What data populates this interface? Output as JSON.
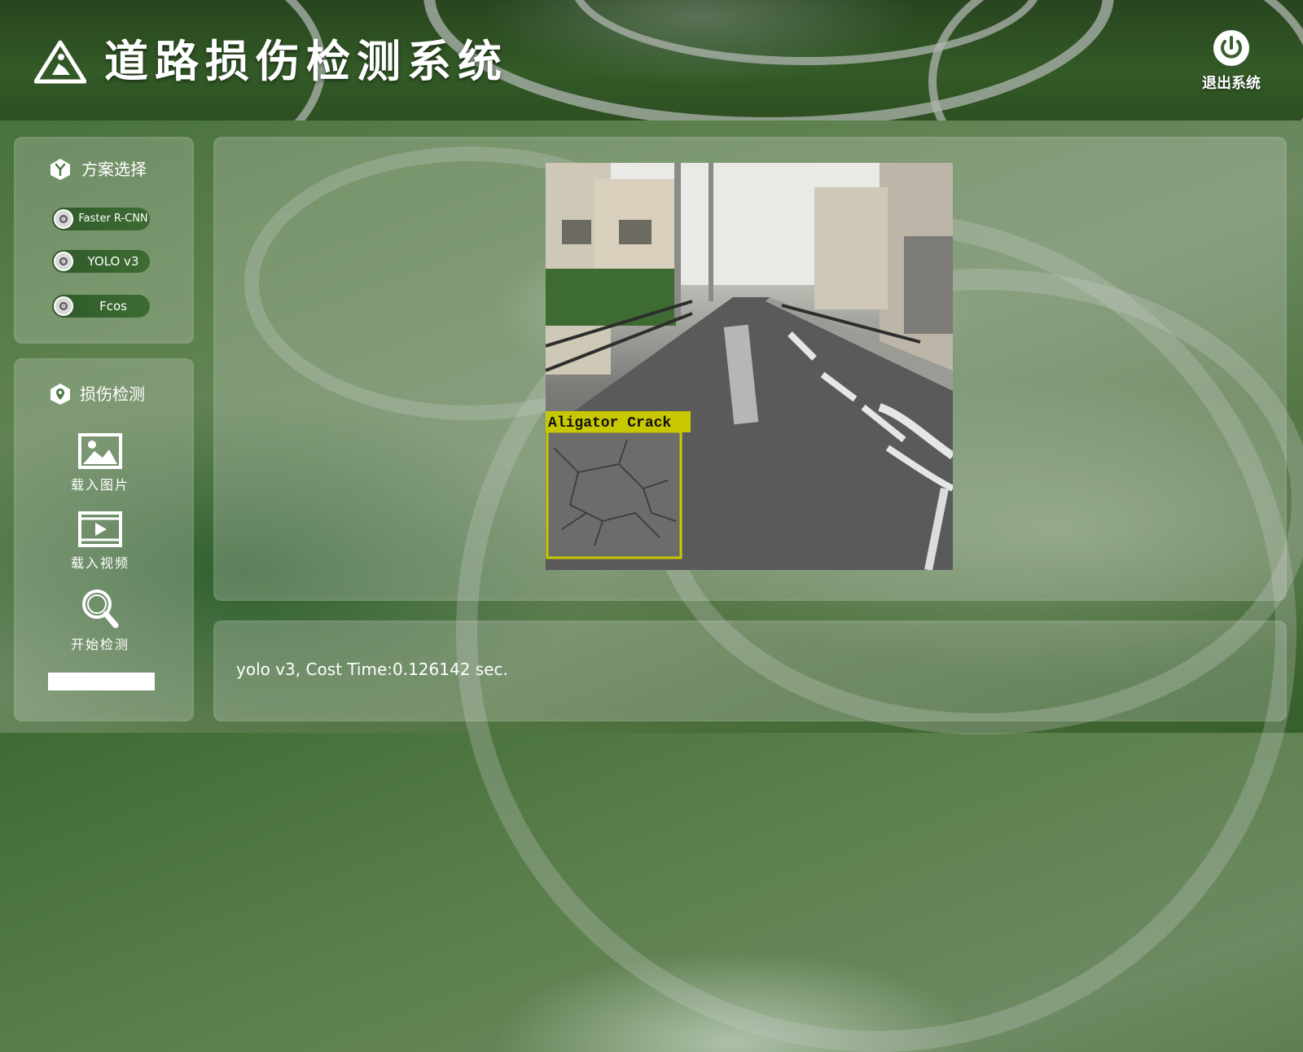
{
  "header": {
    "title": "道路损伤检测系统",
    "exit_label": "退出系统"
  },
  "scheme_panel": {
    "title": "方案选择",
    "options": [
      {
        "label": "Faster R-CNN"
      },
      {
        "label": "YOLO v3"
      },
      {
        "label": "Fcos"
      }
    ]
  },
  "detect_panel": {
    "title": "损伤检测",
    "load_image_label": "载入图片",
    "load_video_label": "载入视频",
    "start_detect_label": "开始检测",
    "progress": 0
  },
  "detection": {
    "box_label": "Aligator Crack",
    "box_color": "#c8c800"
  },
  "output": {
    "text": "yolo v3, Cost Time:0.126142 sec."
  },
  "icons": {
    "title_icon": "warning-worker-icon",
    "exit_icon": "power-icon",
    "scheme_icon": "hexagon-y-icon",
    "detect_icon": "map-pin-icon",
    "load_image_icon": "image-icon",
    "load_video_icon": "video-icon",
    "start_detect_icon": "magnifier-icon"
  }
}
